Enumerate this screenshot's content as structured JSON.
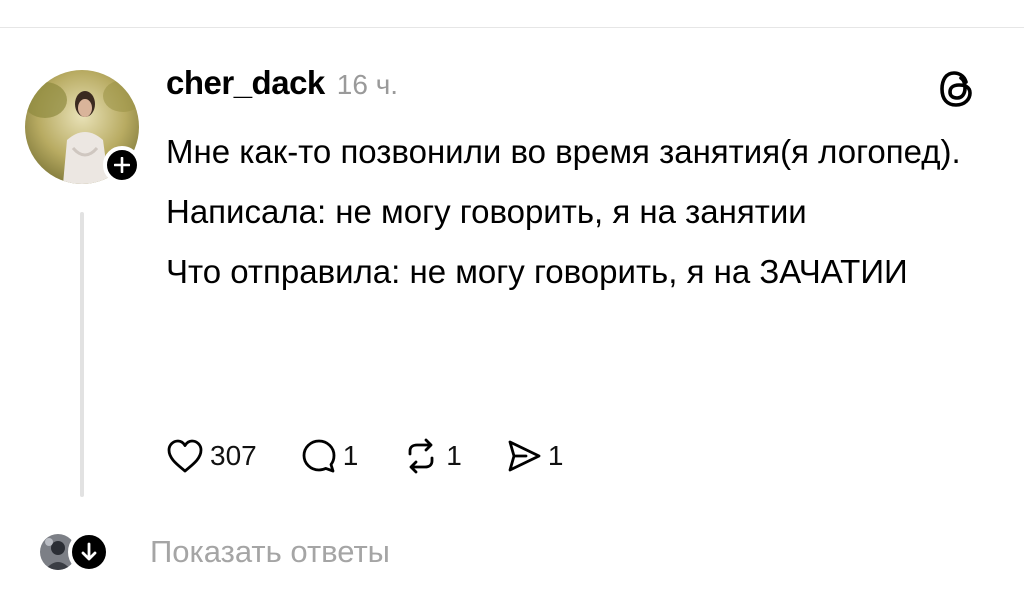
{
  "post": {
    "username": "cher_dack",
    "timestamp": "16 ч.",
    "paragraphs": [
      "Мне как-то позвонили во время занятия(я логопед).",
      "Написала: не могу говорить, я на занятии",
      "Что отправила: не могу говорить, я на ЗАЧАТИИ"
    ],
    "avatar_icon": "profile-photo",
    "follow_icon": "plus-icon",
    "platform_icon": "threads-logo"
  },
  "actions": {
    "like_count": "307",
    "reply_count": "1",
    "repost_count": "1",
    "share_count": "1"
  },
  "replies": {
    "show_label": "Показать ответы",
    "expand_icon": "arrow-down-icon"
  }
}
